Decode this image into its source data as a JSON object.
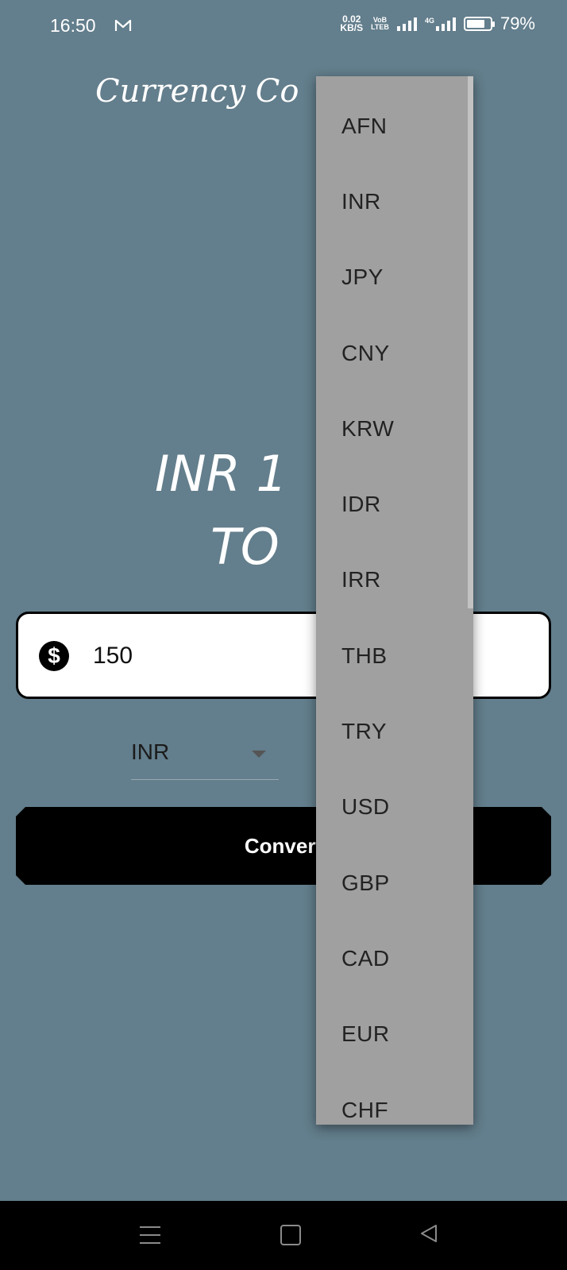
{
  "status_bar": {
    "time": "16:50",
    "net_speed_value": "0.02",
    "net_speed_unit": "KB/S",
    "volte_top": "VoB",
    "volte_bottom": "LTEB",
    "signal2_label": "4G",
    "battery_percent": "79%",
    "battery_level": 0.79
  },
  "app": {
    "title": "Currency Co",
    "result_line1": "INR 1",
    "result_line2": "TO"
  },
  "amount": {
    "value": "150",
    "icon": "dollar-circle-icon"
  },
  "from_currency": {
    "selected": "INR"
  },
  "convert_button": {
    "label": "Convert"
  },
  "dropdown": {
    "options": [
      "AFN",
      "INR",
      "JPY",
      "CNY",
      "KRW",
      "IDR",
      "IRR",
      "THB",
      "TRY",
      "USD",
      "GBP",
      "CAD",
      "EUR",
      "CHF"
    ]
  },
  "colors": {
    "background": "#637e8c",
    "dropdown": "#a0a0a0",
    "button": "#000000",
    "input": "#ffffff"
  },
  "nav": {
    "icons": [
      "menu-icon",
      "home-icon",
      "back-icon"
    ]
  }
}
